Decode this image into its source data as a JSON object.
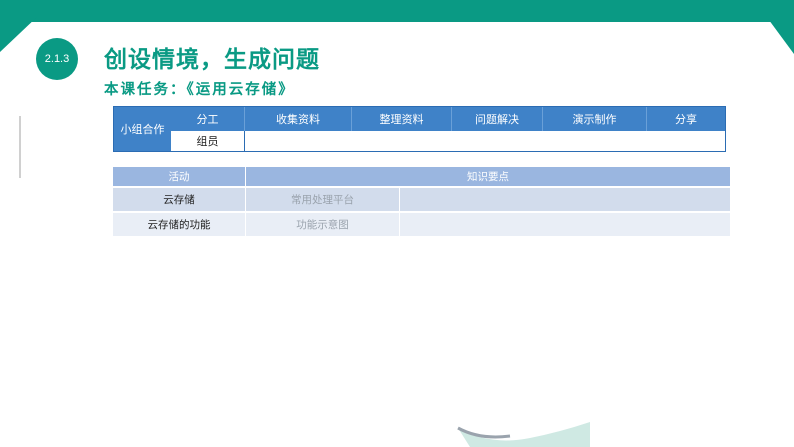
{
  "section": {
    "number": "2.1.3"
  },
  "title": "创设情境，生成问题",
  "subtitle": "本课任务：《运用云存储》",
  "group_table": {
    "label": "小组合作",
    "headers": [
      "分工",
      "收集资料",
      "整理资料",
      "问题解决",
      "演示制作",
      "分享"
    ],
    "row_label": "组员",
    "row_cells": [
      "",
      "",
      "",
      "",
      ""
    ]
  },
  "activity_table": {
    "headers": [
      "活动",
      "知识要点"
    ],
    "rows": [
      {
        "activity": "云存储",
        "point": "常用处理平台",
        "extra": ""
      },
      {
        "activity": "云存储的功能",
        "point": "功能示意图",
        "extra": ""
      }
    ]
  },
  "colors": {
    "accent": "#0a9a84",
    "table_header": "#3f82c8",
    "activity_header": "#9ab6e0"
  }
}
